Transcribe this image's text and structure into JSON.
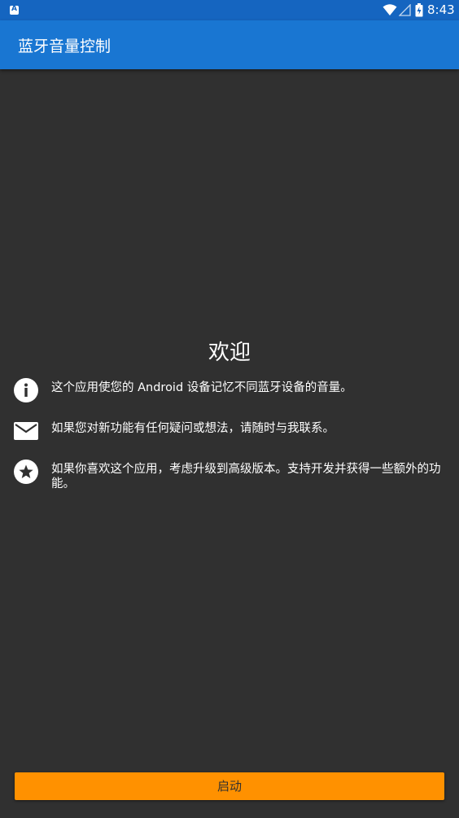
{
  "status_bar": {
    "time": "8:43",
    "icons": [
      "notification-a-icon",
      "wifi-icon",
      "signal-icon",
      "battery-icon"
    ]
  },
  "app_bar": {
    "title": "蓝牙音量控制"
  },
  "welcome": {
    "title": "欢迎",
    "items": [
      {
        "icon": "info-icon",
        "text": "这个应用使您的 Android 设备记忆不同蓝牙设备的音量。"
      },
      {
        "icon": "mail-icon",
        "text": "如果您对新功能有任何疑问或想法，请随时与我联系。"
      },
      {
        "icon": "star-icon",
        "text": "如果你喜欢这个应用，考虑升级到高级版本。支持开发并获得一些额外的功能。"
      }
    ]
  },
  "start_button": {
    "label": "启动"
  },
  "colors": {
    "status_bar": "#1565c0",
    "app_bar": "#1976d2",
    "background": "#303030",
    "accent_button": "#ff9100"
  }
}
